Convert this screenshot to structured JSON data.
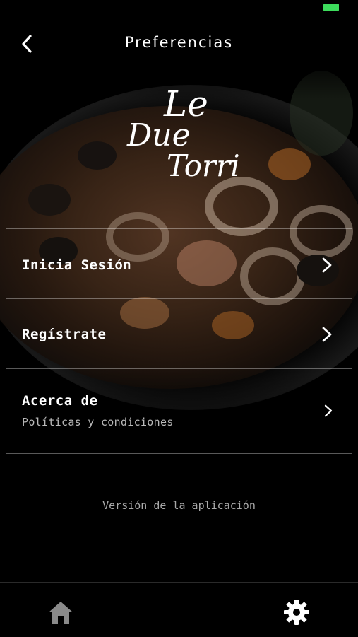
{
  "status_bar": {
    "battery_color": "#3ddc5c"
  },
  "nav": {
    "title": "Preferencias",
    "back_icon": "chevron-left-icon"
  },
  "logo": {
    "line1": "Le",
    "line2": "Due",
    "line3": "Torri"
  },
  "menu": {
    "items": [
      {
        "label": "Inicia Sesión",
        "icon": "chevron-right-icon"
      },
      {
        "label": "Regístrate",
        "icon": "chevron-right-icon"
      },
      {
        "label": "Acerca de",
        "sublabel": "Políticas y condiciones",
        "icon": "chevron-right-icon"
      }
    ]
  },
  "version": {
    "label": "Versión de la aplicación"
  },
  "tabbar": {
    "tabs": [
      {
        "icon": "home-icon",
        "active": false
      },
      {
        "icon": "gear-icon",
        "active": true
      }
    ]
  }
}
